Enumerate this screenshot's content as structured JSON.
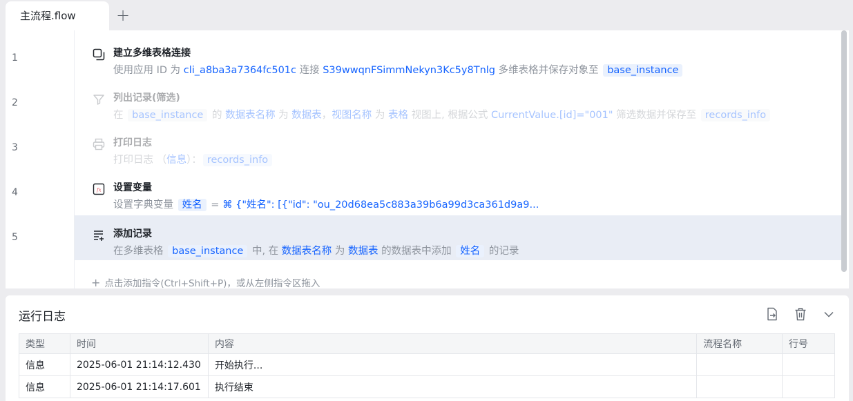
{
  "tabs": {
    "active_label": "主流程.flow",
    "add_label": "+"
  },
  "editor": {
    "line_numbers": [
      "1",
      "2",
      "3",
      "4",
      "5"
    ],
    "steps": [
      {
        "title": "建立多维表格连接",
        "icon": "copy-icon",
        "parts": [
          "使用应用 ID 为 ",
          "cli_a8ba3a7364fc501c",
          " 连接 ",
          "S39wwqnFSimmNekyn3Kc5y8Tnlg",
          " 多维表格并保存对象至 ",
          "base_instance"
        ]
      },
      {
        "title": "列出记录(筛选)",
        "icon": "filter-icon",
        "parts": [
          "在 ",
          "base_instance",
          " 的 ",
          "数据表名称",
          " 为 ",
          "数据表",
          "，",
          "视图名称",
          " 为 ",
          "表格",
          " 视图上, 根据公式 ",
          "CurrentValue.[id]=\"001\"",
          " 筛选数据并保存至 ",
          "records_info"
        ]
      },
      {
        "title": "打印日志",
        "icon": "printer-icon",
        "parts": [
          "打印日志 （",
          "信息",
          "）：",
          "records_info"
        ]
      },
      {
        "title": "设置变量",
        "icon": "fx-variable-icon",
        "parts": [
          "设置字典变量 ",
          "姓名",
          " = ",
          "{\"姓名\": [{\"id\": \"ou_20d68ea5c883a39b6a99d3ca361d9a9..."
        ]
      },
      {
        "title": "添加记录",
        "icon": "add-record-icon",
        "parts": [
          "在多维表格 ",
          "base_instance",
          " 中, 在 ",
          "数据表名称",
          " 为 ",
          "数据表",
          " 的数据表中添加 ",
          "姓名",
          " 的记录"
        ]
      }
    ],
    "add_hint": "点击添加指令(Ctrl+Shift+P)，或从左侧指令区拖入"
  },
  "log": {
    "title": "运行日志",
    "columns": [
      "类型",
      "时间",
      "内容",
      "流程名称",
      "行号"
    ],
    "rows": [
      [
        "信息",
        "2025-06-01 21:14:12.430",
        "开始执行...",
        "",
        ""
      ],
      [
        "信息",
        "2025-06-01 21:14:17.601",
        "执行结束",
        "",
        ""
      ]
    ]
  },
  "colors": {
    "accent": "#1664ff",
    "active_row": "#e9edf5",
    "chip_bg": "#eaf1fd"
  }
}
